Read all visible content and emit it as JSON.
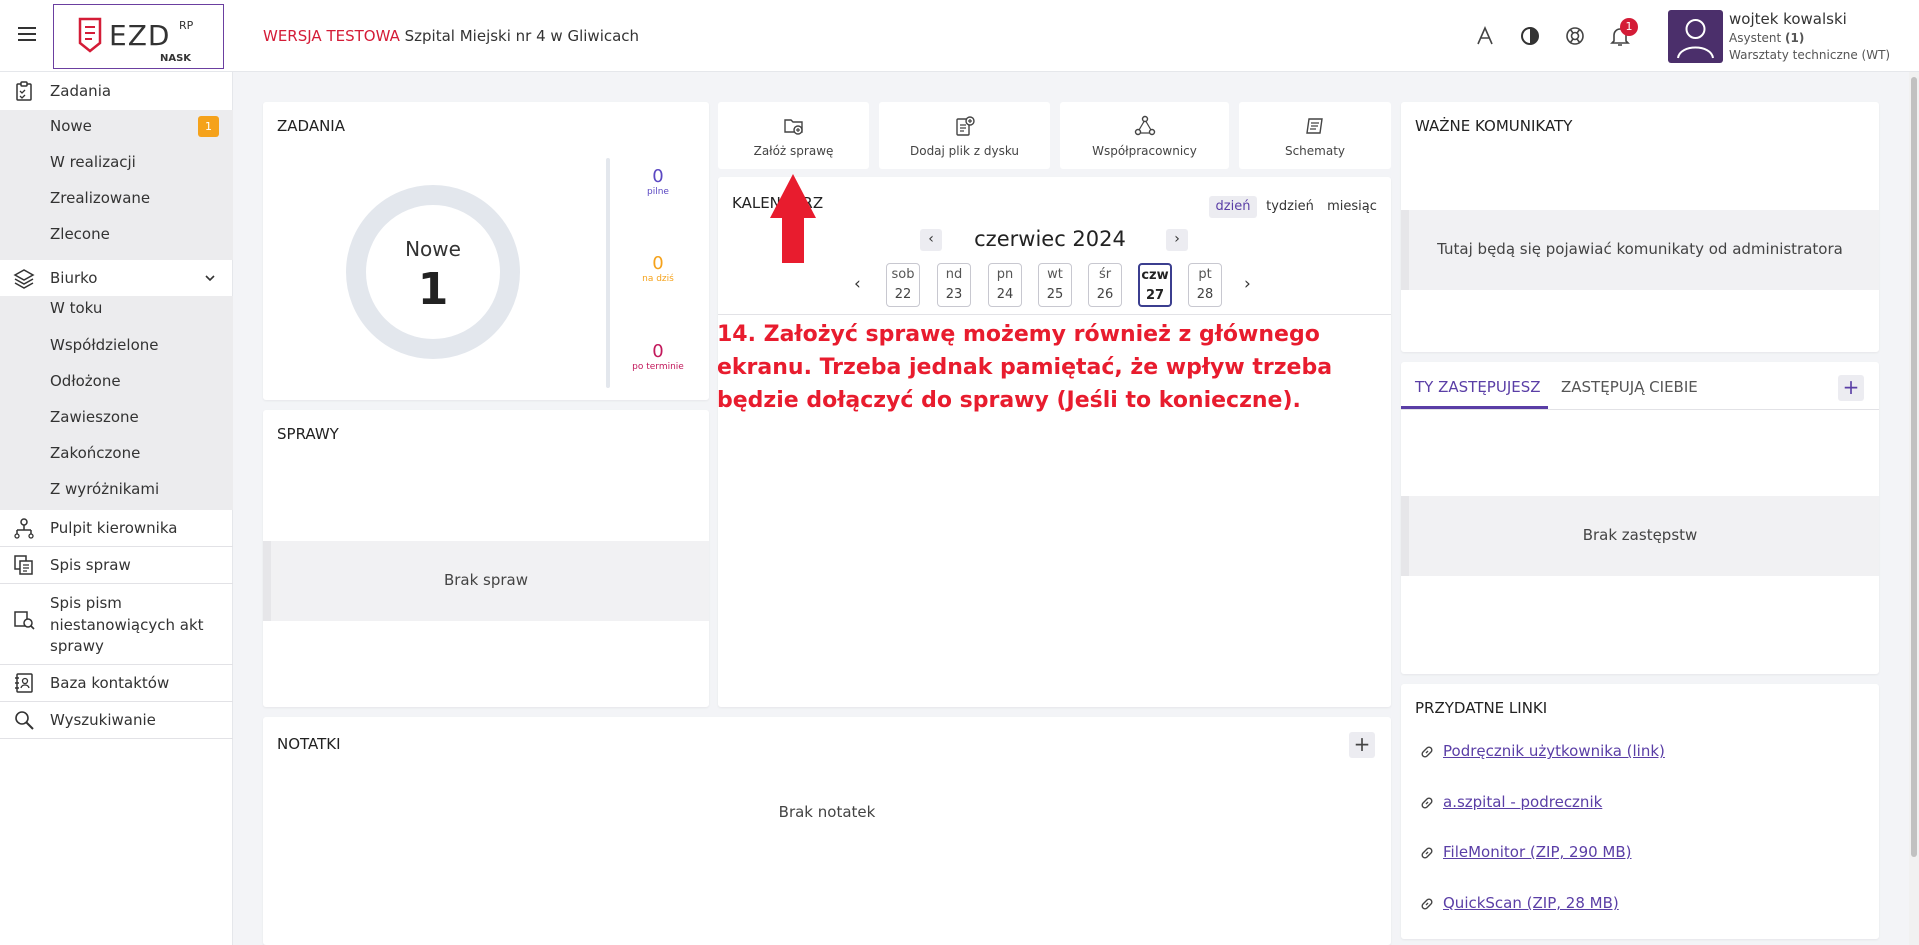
{
  "header": {
    "env_label": "WERSJA TESTOWA",
    "hospital": "Szpital Miejski nr 4 w Gliwicach",
    "logo_text": "EZD",
    "logo_sup": "RP",
    "logo_sub": "NASK",
    "notification_count": "1",
    "user_name": "wojtek kowalski",
    "user_role_label": "Asystent",
    "user_role_count": "(1)",
    "user_dept": "Warsztaty techniczne (WT)"
  },
  "sidebar": {
    "zadania": "Zadania",
    "zadania_items": [
      "Nowe",
      "W realizacji",
      "Zrealizowane",
      "Zlecone"
    ],
    "nowe_badge": "1",
    "biurko": "Biurko",
    "biurko_items": [
      "W toku",
      "Współdzielone",
      "Odłożone",
      "Zawieszone",
      "Zakończone",
      "Z wyróżnikami"
    ],
    "pulpit": "Pulpit kierownika",
    "spis_spraw": "Spis spraw",
    "spis_pism": [
      "Spis pism",
      "niestanowiących akt",
      "sprawy"
    ],
    "baza": "Baza kontaktów",
    "wyszukiwanie": "Wyszukiwanie"
  },
  "zadania_card": {
    "title": "ZADANIA",
    "donut_label": "Nowe",
    "donut_value": "1",
    "stats": [
      {
        "value": "0",
        "label": "pilne",
        "color": "#5b48c2"
      },
      {
        "value": "0",
        "label": "na dziś",
        "color": "#f5a21b"
      },
      {
        "value": "0",
        "label": "po terminie",
        "color": "#c2185b"
      }
    ]
  },
  "actions": [
    "Załóż sprawę",
    "Dodaj plik z dysku",
    "Współpracownicy",
    "Schematy"
  ],
  "calendar": {
    "title": "KALENDARZ",
    "views": [
      "dzień",
      "tydzień",
      "miesiąc"
    ],
    "month": "czerwiec 2024",
    "days": [
      {
        "dow": "sob",
        "day": "22"
      },
      {
        "dow": "nd",
        "day": "23"
      },
      {
        "dow": "pn",
        "day": "24"
      },
      {
        "dow": "wt",
        "day": "25"
      },
      {
        "dow": "śr",
        "day": "26"
      },
      {
        "dow": "czw",
        "day": "27"
      },
      {
        "dow": "pt",
        "day": "28"
      }
    ]
  },
  "annotation": "14. Założyć sprawę możemy również z głównego ekranu. Trzeba jednak pamiętać, że wpływ trzeba będzie dołączyć do sprawy (Jeśli to konieczne).",
  "sprawy_card": {
    "title": "SPRAWY",
    "empty": "Brak spraw"
  },
  "notatki_card": {
    "title": "NOTATKI",
    "empty": "Brak notatek"
  },
  "komunikaty_card": {
    "title": "WAŻNE KOMUNIKATY",
    "empty": "Tutaj będą się pojawiać komunikaty od administratora"
  },
  "zastepstwa_card": {
    "tab_active": "TY ZASTĘPUJESZ",
    "tab_other": "ZASTĘPUJĄ CIEBIE",
    "empty": "Brak zastępstw"
  },
  "links_card": {
    "title": "PRZYDATNE LINKI",
    "links": [
      "Podręcznik użytkownika (link)",
      "a.szpital - podrecznik",
      "FileMonitor (ZIP, 290 MB)",
      "QuickScan (ZIP, 28 MB)"
    ]
  }
}
